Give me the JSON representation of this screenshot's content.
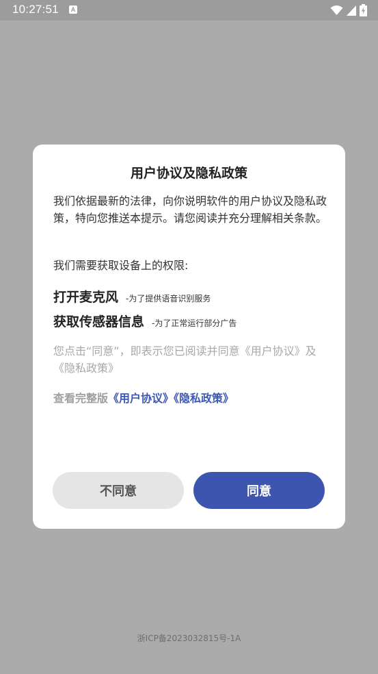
{
  "status_bar": {
    "time": "10:27:51",
    "notification_icon": "A"
  },
  "dialog": {
    "title": "用户协议及隐私政策",
    "intro": "我们依据最新的法律，向你说明软件的用户协议及隐私政策，特向您推送本提示。请您阅读并充分理解相关条款。",
    "permissions_heading": "我们需要获取设备上的权限:",
    "permissions": [
      {
        "name": "打开麦克风",
        "purpose": "-为了提供语音识别服务"
      },
      {
        "name": "获取传感器信息",
        "purpose": "-为了正常运行部分广告"
      }
    ],
    "notice": "您点击“同意”，即表示您已阅读并同意《用户协议》及《隐私政策》",
    "links": {
      "prefix": "查看完整版",
      "user_agreement": "《用户协议》",
      "privacy_policy": "《隐私政策》"
    },
    "buttons": {
      "disagree": "不同意",
      "agree": "同意"
    }
  },
  "footer": {
    "icp": "浙ICP备2023032815号-1A"
  },
  "colors": {
    "backdrop": "#ababab",
    "accent": "#3e55b0",
    "link": "#3e58b5",
    "secondary_button": "#e5e5e5"
  }
}
